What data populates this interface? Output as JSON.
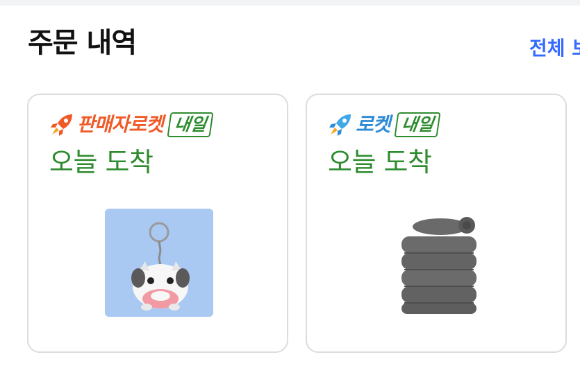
{
  "section": {
    "title": "주문 내역",
    "view_all_label": "전체 보기"
  },
  "orders": [
    {
      "delivery_type": "판매자로켓",
      "delivery_tag": "내일",
      "arrival_text": "오늘 도착",
      "rocket_icon": "rocket-icon-orange",
      "product_image": "poro-keychain-image",
      "thumbnail_bg": "#a9c9f2"
    },
    {
      "delivery_type": "로켓",
      "delivery_tag": "내일",
      "arrival_text": "오늘 도착",
      "rocket_icon": "rocket-icon-blue",
      "product_image": "gray-towel-stack-image",
      "thumbnail_bg": "#ffffff"
    }
  ],
  "colors": {
    "accent_blue": "#346aff",
    "arrival_green": "#2e8b2e",
    "seller_rocket_orange": "#f05a28",
    "rocket_blue": "#2d8ad6"
  }
}
